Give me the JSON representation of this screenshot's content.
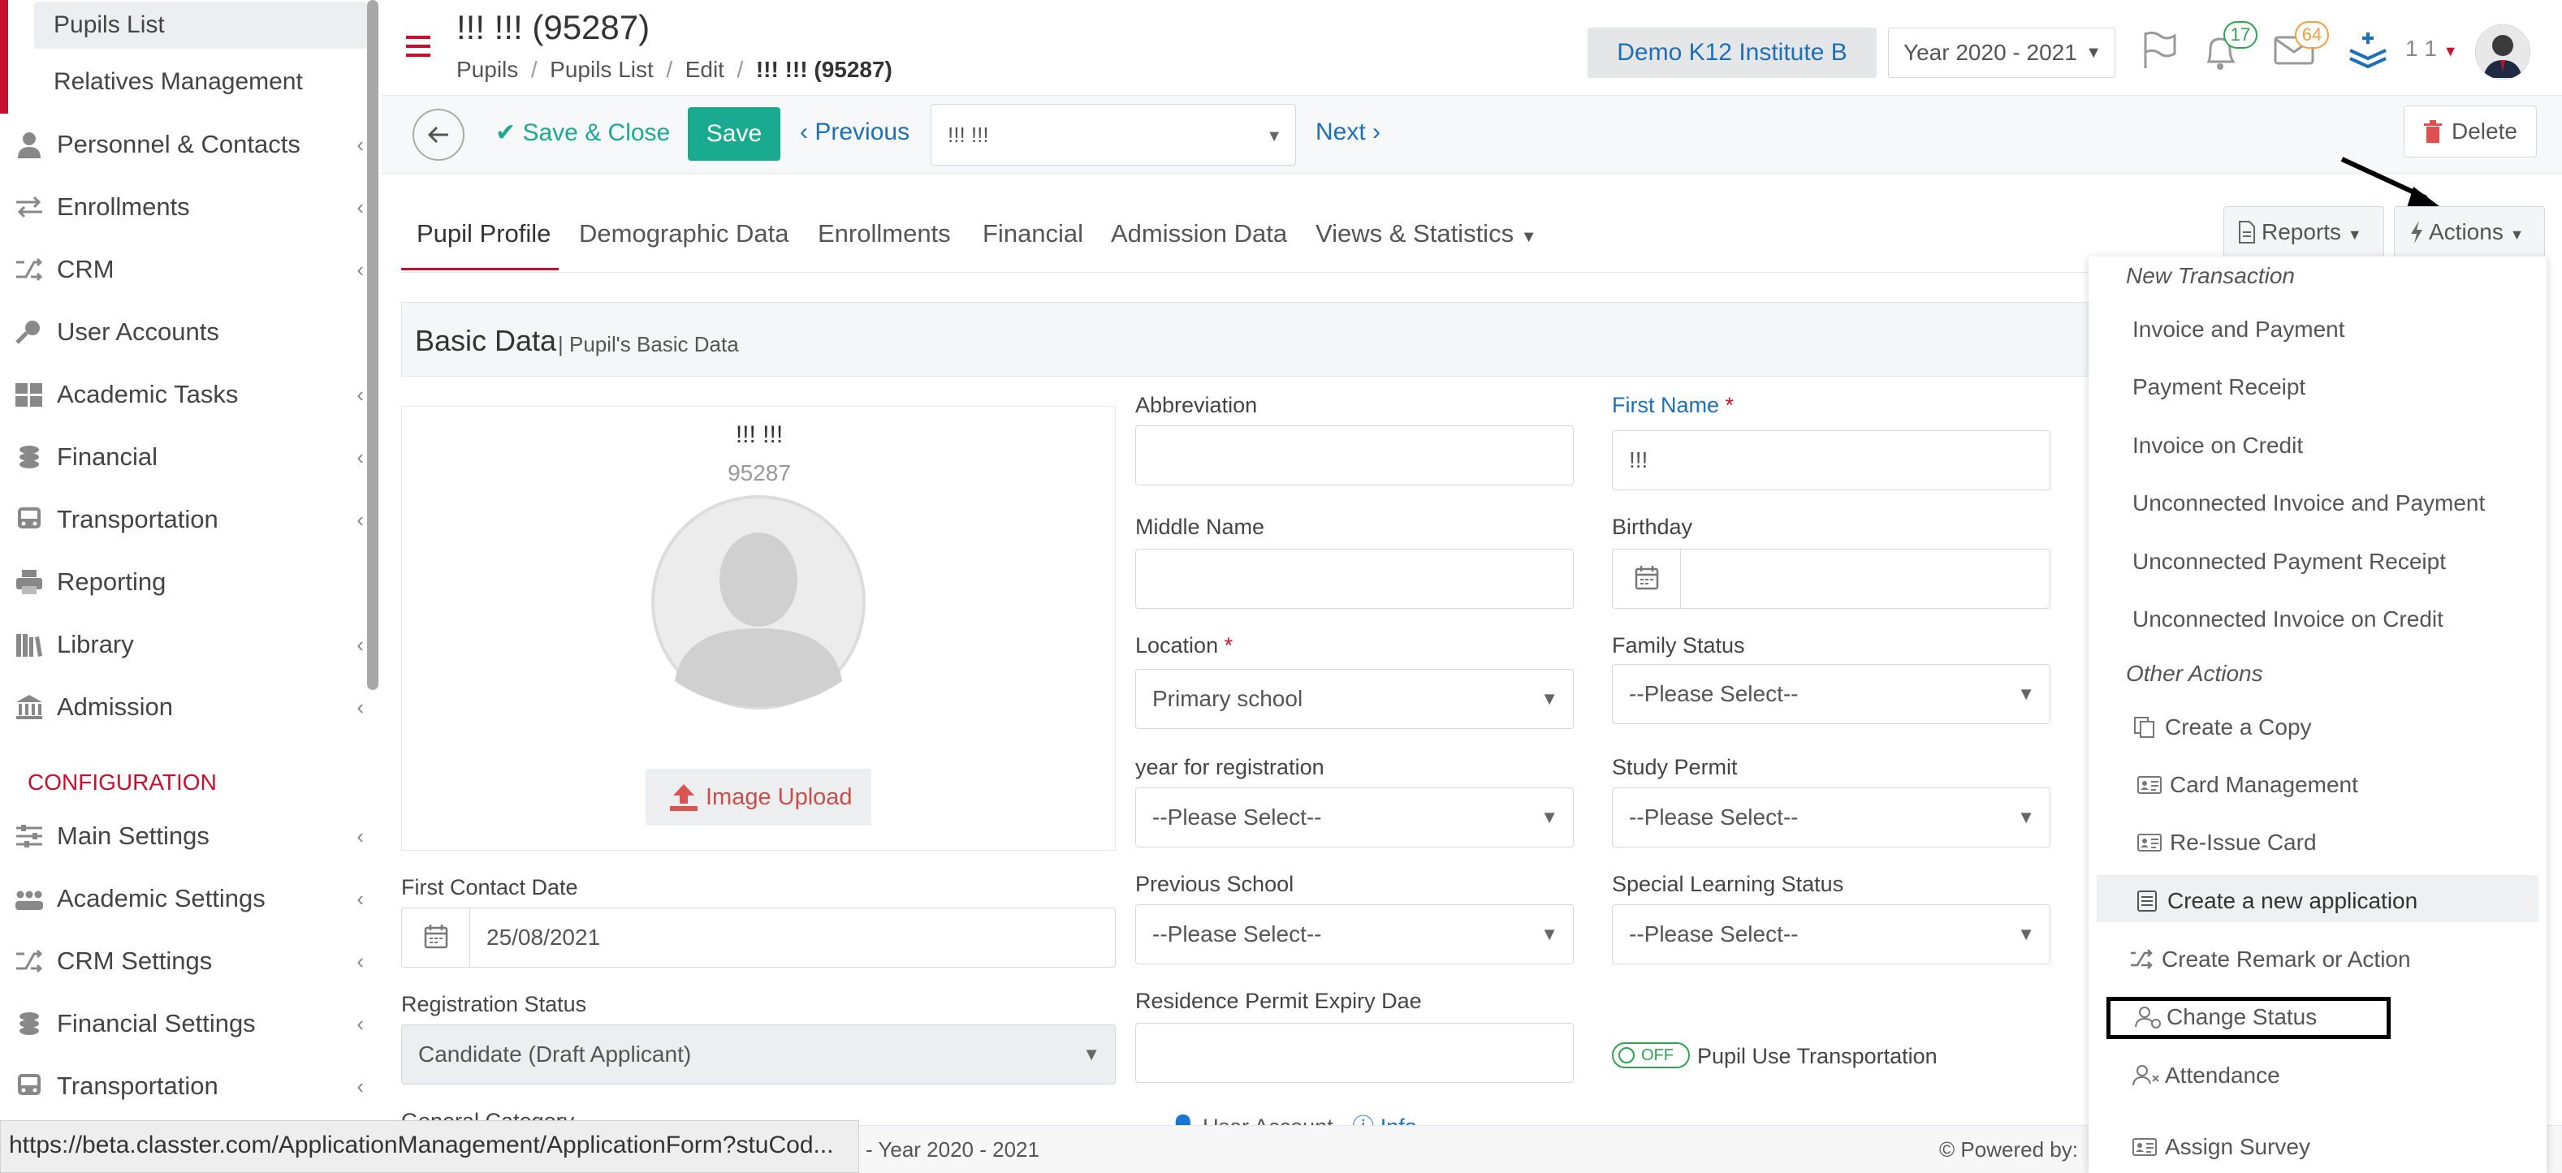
{
  "sidebar": {
    "sub_items": [
      "Pupils List",
      "Relatives Management"
    ],
    "items": [
      {
        "label": "Personnel & Contacts",
        "icon": "person-icon"
      },
      {
        "label": "Enrollments",
        "icon": "arrows-swap-icon"
      },
      {
        "label": "CRM",
        "icon": "shuffle-icon"
      },
      {
        "label": "User Accounts",
        "icon": "key-icon"
      },
      {
        "label": "Academic Tasks",
        "icon": "grid-icon"
      },
      {
        "label": "Financial",
        "icon": "coins-icon"
      },
      {
        "label": "Transportation",
        "icon": "bus-icon"
      },
      {
        "label": "Reporting",
        "icon": "printer-icon"
      },
      {
        "label": "Library",
        "icon": "books-icon"
      },
      {
        "label": "Admission",
        "icon": "institution-icon"
      }
    ],
    "config_label": "CONFIGURATION",
    "config_items": [
      {
        "label": "Main Settings",
        "icon": "sliders-icon"
      },
      {
        "label": "Academic Settings",
        "icon": "group-icon"
      },
      {
        "label": "CRM Settings",
        "icon": "shuffle-icon"
      },
      {
        "label": "Financial Settings",
        "icon": "coins-icon"
      },
      {
        "label": "Transportation",
        "icon": "bus-icon"
      }
    ]
  },
  "header": {
    "title": "!!! !!! (95287)",
    "breadcrumb": [
      "Pupils",
      "Pupils List",
      "Edit",
      "!!! !!! (95287)"
    ],
    "institute": "Demo K12 Institute B",
    "year": "Year 2020 - 2021",
    "notifications_count": "17",
    "messages_count": "64",
    "user_label": "1 1"
  },
  "toolbar": {
    "save_close": "Save & Close",
    "save": "Save",
    "previous": "Previous",
    "record_select": "!!! !!!",
    "next": "Next",
    "delete": "Delete"
  },
  "tabs": [
    "Pupil Profile",
    "Demographic Data",
    "Enrollments",
    "Financial",
    "Admission Data",
    "Views & Statistics"
  ],
  "reports_label": "Reports",
  "actions_label": "Actions",
  "panel": {
    "title": "Basic Data",
    "subtitle": "| Pupil's Basic Data"
  },
  "profile": {
    "name": "!!! !!!",
    "id": "95287",
    "upload_label": "Image Upload"
  },
  "form": {
    "abbreviation_label": "Abbreviation",
    "first_name_label": "First Name",
    "first_name_value": "!!!",
    "middle_name_label": "Middle Name",
    "birthday_label": "Birthday",
    "location_label": "Location",
    "location_value": "Primary school",
    "family_status_label": "Family Status",
    "family_status_value": "--Please Select--",
    "year_reg_label": "year for registration",
    "year_reg_value": "--Please Select--",
    "study_permit_label": "Study Permit",
    "study_permit_value": "--Please Select--",
    "first_contact_label": "First Contact Date",
    "first_contact_value": "25/08/2021",
    "previous_school_label": "Previous School",
    "previous_school_value": "--Please Select--",
    "special_learning_label": "Special Learning Status",
    "special_learning_value": "--Please Select--",
    "registration_status_label": "Registration Status",
    "registration_status_value": "Candidate (Draft Applicant)",
    "residence_permit_label": "Residence Permit Expiry Dae",
    "toggle_label": "OFF",
    "transport_label": "Pupil Use Transportation",
    "general_category_label": "General Category",
    "user_account_label": "User Account",
    "info_label": "Info"
  },
  "actions_menu": {
    "new_transaction_header": "New Transaction",
    "new_transaction_items": [
      "Invoice and Payment",
      "Payment Receipt",
      "Invoice on Credit",
      "Unconnected Invoice and Payment",
      "Unconnected Payment Receipt",
      "Unconnected Invoice on Credit"
    ],
    "other_actions_header": "Other Actions",
    "other_actions_items": [
      {
        "label": "Create a Copy",
        "icon": "copy-icon"
      },
      {
        "label": "Card Management",
        "icon": "id-card-icon"
      },
      {
        "label": "Re-Issue Card",
        "icon": "id-card-icon"
      },
      {
        "label": "Create a new application",
        "icon": "form-icon"
      },
      {
        "label": "Create Remark or Action",
        "icon": "shuffle-icon"
      },
      {
        "label": "Change Status",
        "icon": "user-status-icon"
      },
      {
        "label": "Attendance",
        "icon": "user-x-icon"
      },
      {
        "label": "Assign Survey",
        "icon": "id-card-icon"
      }
    ]
  },
  "footer": {
    "url": "https://beta.classter.com/ApplicationManagement/ApplicationForm?stuCod...",
    "year": "- Year 2020 - 2021",
    "powered_by": "Powered by:"
  },
  "colors": {
    "accent_red": "#c8102e",
    "save_green": "#1aaa8f",
    "link_blue": "#1d6fb8",
    "badge_green": "#2ea44f",
    "badge_orange": "#f0a040"
  }
}
